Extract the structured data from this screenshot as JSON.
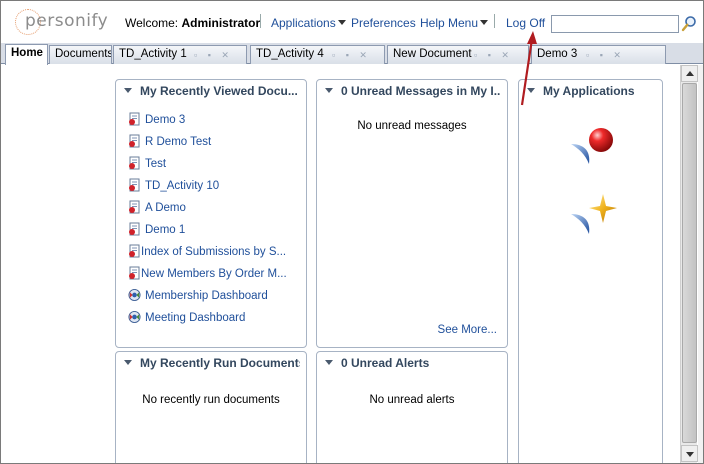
{
  "header": {
    "logo_text": "personify",
    "welcome_prefix": "Welcome:",
    "username": "Administrator",
    "nav": {
      "applications": "Applications",
      "preferences": "Preferences",
      "help_menu": "Help Menu",
      "log_off": "Log Off"
    },
    "search_value": ""
  },
  "tabs": [
    {
      "label": "Home",
      "active": true
    },
    {
      "label": "Documents"
    },
    {
      "label": "TD_Activity 1"
    },
    {
      "label": "TD_Activity 4"
    },
    {
      "label": "New Document"
    },
    {
      "label": "Demo 3"
    }
  ],
  "panels": {
    "recently_viewed": {
      "title": "My Recently Viewed Docu...",
      "items": [
        {
          "label": "Demo 3",
          "icon": "report-doc-icon"
        },
        {
          "label": "R Demo Test",
          "icon": "report-doc-icon"
        },
        {
          "label": "Test",
          "icon": "report-doc-icon"
        },
        {
          "label": "TD_Activity 10",
          "icon": "report-doc-icon"
        },
        {
          "label": "A Demo",
          "icon": "report-doc-icon"
        },
        {
          "label": "Demo 1",
          "icon": "report-doc-icon"
        },
        {
          "label": "Index of Submissions by S...",
          "icon": "report-doc-icon"
        },
        {
          "label": "New Members By Order M...",
          "icon": "report-doc-icon"
        },
        {
          "label": "Membership Dashboard",
          "icon": "dashboard-icon"
        },
        {
          "label": "Meeting Dashboard",
          "icon": "dashboard-icon"
        }
      ]
    },
    "unread_messages": {
      "title": "0 Unread Messages in My I...",
      "message": "No unread messages",
      "see_more": "See More..."
    },
    "my_applications": {
      "title": "My Applications",
      "apps": [
        {
          "icon": "red-sphere-app-icon"
        },
        {
          "icon": "gold-star-app-icon"
        }
      ]
    },
    "recently_run": {
      "title": "My Recently Run Documents",
      "message": "No recently run documents"
    },
    "unread_alerts": {
      "title": "0 Unread Alerts",
      "message": "No unread alerts"
    }
  },
  "colors": {
    "link": "#1f4f9a",
    "panel_border": "#a7b3c4",
    "annotation_arrow": "#b01c20"
  }
}
